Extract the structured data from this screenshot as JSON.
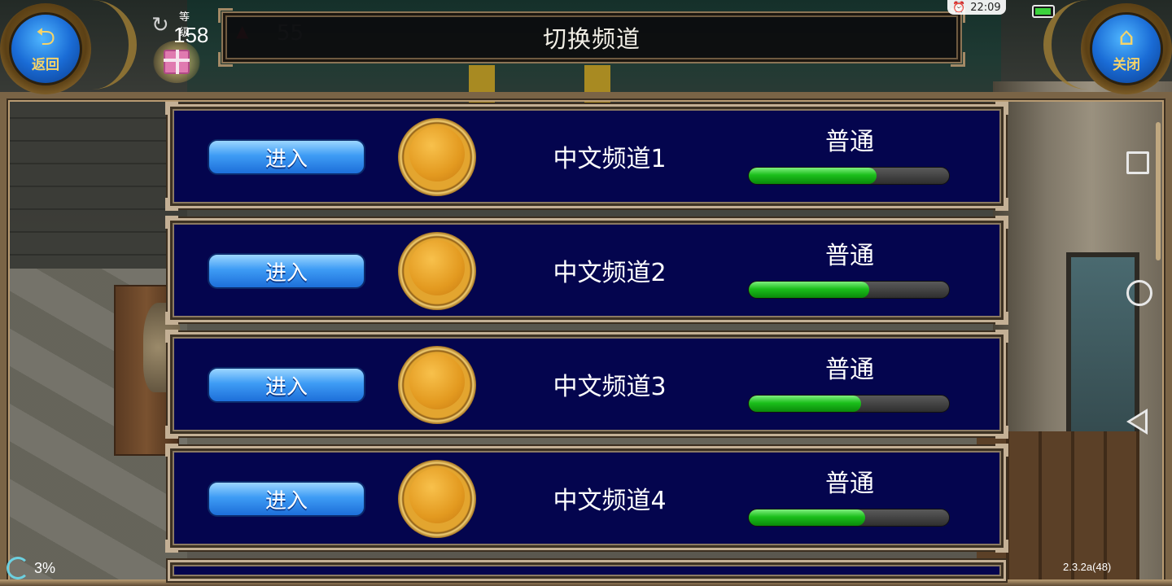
{
  "header": {
    "title": "切换频道",
    "back_label": "返回",
    "close_label": "关闭",
    "back_icon": "undo-arrow-icon",
    "close_icon": "home-icon"
  },
  "player": {
    "level_label": "等级",
    "level_value": "158",
    "faded_value": "55"
  },
  "status": {
    "time": "22:09",
    "battery_level": 0.95,
    "network_percent": "3%",
    "version": "2.3.2a(48)"
  },
  "channels": [
    {
      "enter_label": "进入",
      "name": "中文频道1",
      "load_label": "普通",
      "load": 0.64
    },
    {
      "enter_label": "进入",
      "name": "中文频道2",
      "load_label": "普通",
      "load": 0.6
    },
    {
      "enter_label": "进入",
      "name": "中文频道3",
      "load_label": "普通",
      "load": 0.56
    },
    {
      "enter_label": "进入",
      "name": "中文频道4",
      "load_label": "普通",
      "load": 0.58
    }
  ],
  "colors": {
    "panel_bg": "#04054e",
    "enter_button": "#3e9cf5",
    "load_fill": "#1bbf1b",
    "frame_gold": "#c4b095"
  }
}
